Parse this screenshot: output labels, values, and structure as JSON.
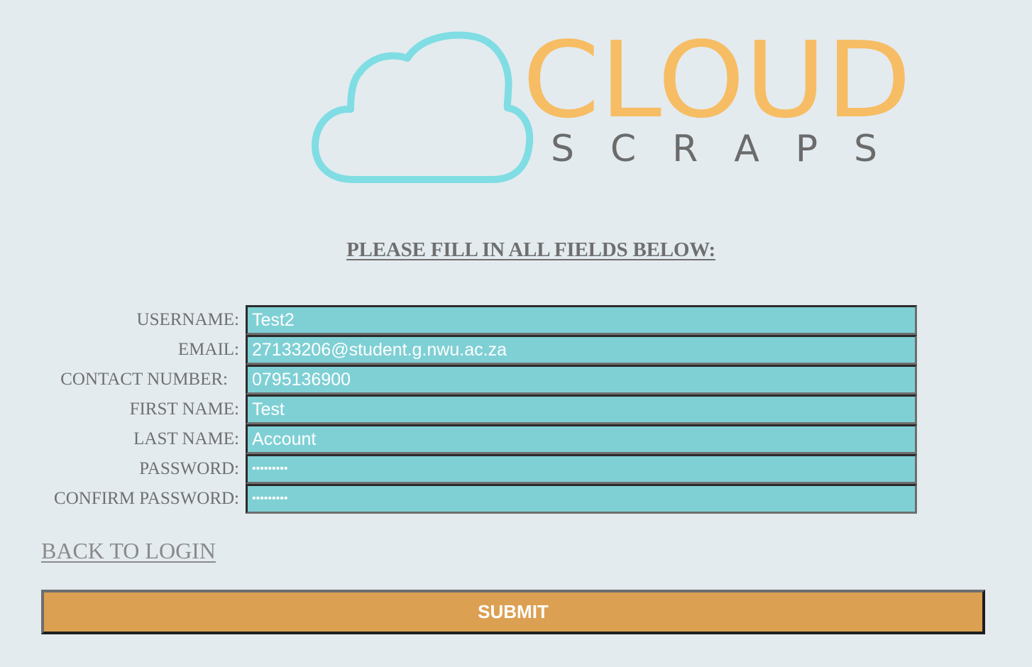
{
  "logo": {
    "word_top": "CLOUD",
    "word_bottom": "S C R A P S",
    "cloud_color": "#7fdde3",
    "top_color": "#f7bd64",
    "bottom_color": "#6b6b6b"
  },
  "heading": "PLEASE FILL IN ALL FIELDS BELOW:",
  "form": {
    "fields": [
      {
        "label": "USERNAME:",
        "value": "Test2"
      },
      {
        "label": "EMAIL:",
        "value": "27133206@student.g.nwu.ac.za"
      },
      {
        "label": "CONTACT NUMBER:",
        "value": "0795136900"
      },
      {
        "label": "FIRST NAME:",
        "value": "Test"
      },
      {
        "label": "LAST NAME:",
        "value": "Account"
      },
      {
        "label": "PASSWORD:",
        "value": "•••••••••"
      },
      {
        "label": "CONFIRM PASSWORD:",
        "value": "•••••••••"
      }
    ]
  },
  "back_link": "BACK TO LOGIN",
  "submit_label": "SUBMIT",
  "colors": {
    "background": "#e3ebef",
    "field_fill": "#7fd0d5",
    "submit_fill": "#dca052",
    "label_text": "#6f6f6f"
  }
}
